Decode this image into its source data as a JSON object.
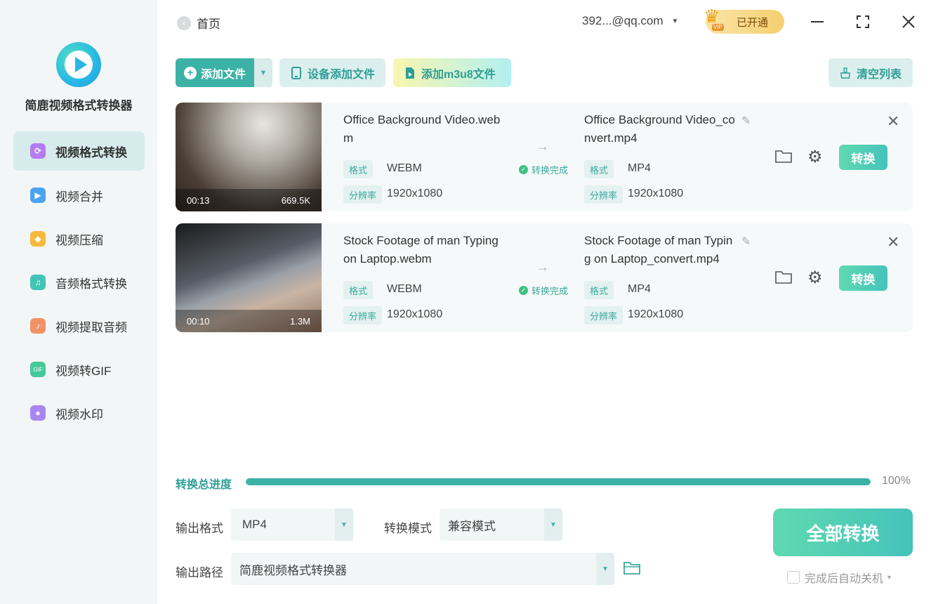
{
  "app": {
    "name": "简鹿视频格式转换器"
  },
  "sidebar": {
    "items": [
      {
        "label": "视频格式转换",
        "icon": "video-convert-icon",
        "color": "#b57cf2"
      },
      {
        "label": "视频合并",
        "icon": "video-merge-icon",
        "color": "#4aa3f0"
      },
      {
        "label": "视频压缩",
        "icon": "video-compress-icon",
        "color": "#f5b93c"
      },
      {
        "label": "音频格式转换",
        "icon": "audio-convert-icon",
        "color": "#41c4b5"
      },
      {
        "label": "视频提取音频",
        "icon": "extract-audio-icon",
        "color": "#f29266"
      },
      {
        "label": "视频转GIF",
        "icon": "gif-icon",
        "color": "#46c99a"
      },
      {
        "label": "视频水印",
        "icon": "watermark-icon",
        "color": "#a987f2"
      }
    ]
  },
  "topbar": {
    "home_label": "首页",
    "account": "392...@qq.com",
    "vip_badge": "VIP",
    "vip_label": "已开通"
  },
  "toolbar": {
    "add_file": "添加文件",
    "device_add": "设备添加文件",
    "m3u8_add": "添加m3u8文件",
    "clear_list": "清空列表"
  },
  "labels": {
    "format": "格式",
    "resolution": "分辨率",
    "convert": "转换",
    "done": "转换完成"
  },
  "files": [
    {
      "source_name": "Office Background Video.webm",
      "duration": "00:13",
      "size": "669.5K",
      "source_format": "WEBM",
      "source_resolution": "1920x1080",
      "status": "转换完成",
      "output_name": "Office Background Video_convert.mp4",
      "output_format": "MP4",
      "output_resolution": "1920x1080"
    },
    {
      "source_name": "Stock Footage of man Typing on Laptop.webm",
      "duration": "00:10",
      "size": "1.3M",
      "source_format": "WEBM",
      "source_resolution": "1920x1080",
      "status": "转换完成",
      "output_name": "Stock Footage of man Typing on Laptop_convert.mp4",
      "output_format": "MP4",
      "output_resolution": "1920x1080"
    }
  ],
  "progress": {
    "label": "转换总进度",
    "percent_text": "100%",
    "fraction": 1.0
  },
  "settings": {
    "output_format_label": "输出格式",
    "output_format_value": "MP4",
    "mode_label": "转换模式",
    "mode_value": "兼容模式",
    "path_label": "输出路径",
    "path_value": "简鹿视频格式转换器"
  },
  "actions": {
    "convert_all": "全部转换",
    "auto_shutdown": "完成后自动关机"
  },
  "colors": {
    "accent": "#3cb2a6",
    "active_nav_bg": "#d6ecec"
  }
}
